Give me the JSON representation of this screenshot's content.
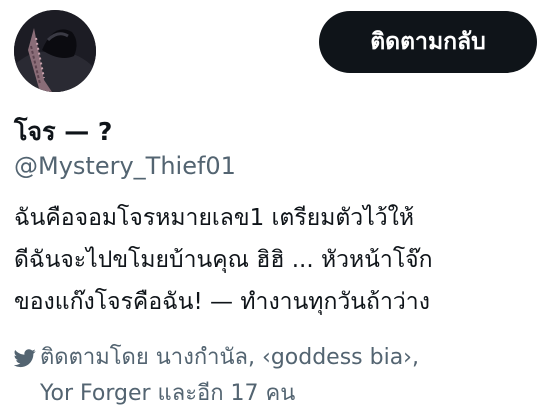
{
  "profile": {
    "follow_button_label": "ติดตามกลับ",
    "display_name": "โจร — ?",
    "handle": "@Mystery_Thief01",
    "bio_lines": [
      "ฉันคือจอมโจรหมายเลข1 เตรียมตัวไว้ให้",
      "ดีฉันจะไปขโมยบ้านคุณ ฮิฮิ ... หัวหน้าโจ๊ก",
      "ของแก๊งโจรคือฉัน! — ทำงานทุกวันถ้าว่าง"
    ],
    "followed_by_line1": "ติดตามโดย นางกำนัล, ‹goddess bia›,",
    "followed_by_line2": "Yor Forger และอีก 17 คน"
  },
  "colors": {
    "button_bg": "#0f1419",
    "secondary_text": "#536471",
    "primary_text": "#0f1419"
  },
  "icons": {
    "follower_indicator": "twitter-bird-icon"
  }
}
